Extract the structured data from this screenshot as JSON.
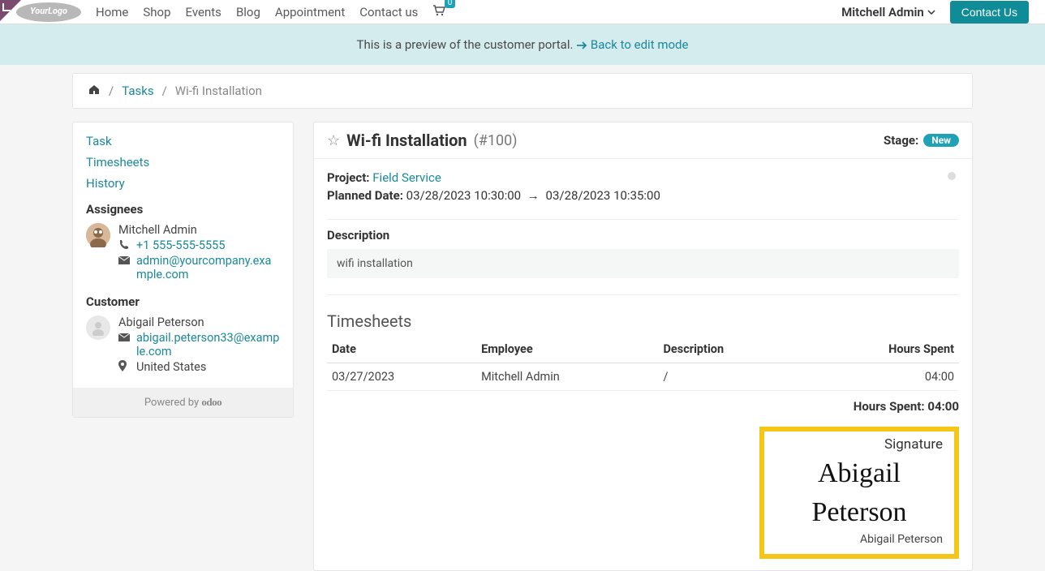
{
  "nav": {
    "logo_text": "YourLogo",
    "links": [
      "Home",
      "Shop",
      "Events",
      "Blog",
      "Appointment",
      "Contact us"
    ],
    "cart_count": "0",
    "user": "Mitchell Admin",
    "contact_btn": "Contact Us"
  },
  "banner": {
    "text": "This is a preview of the customer portal.",
    "link": "Back to edit mode"
  },
  "breadcrumbs": {
    "tasks": "Tasks",
    "current": "Wi-fi Installation"
  },
  "sidebar": {
    "links": {
      "task": "Task",
      "timesheets": "Timesheets",
      "history": "History"
    },
    "assignees_h": "Assignees",
    "assignee": {
      "name": "Mitchell Admin",
      "phone": "+1 555-555-5555",
      "email": "admin@yourcompany.example.com"
    },
    "customer_h": "Customer",
    "customer": {
      "name": "Abigail Peterson",
      "email": "abigail.peterson33@example.com",
      "country": "United States"
    },
    "powered": "Powered by",
    "powered_brand": "odoo"
  },
  "task": {
    "title": "Wi-fi Installation",
    "id": "(#100)",
    "stage_label": "Stage:",
    "stage": "New",
    "project_label": "Project:",
    "project": "Field Service",
    "planned_label": "Planned Date:",
    "planned_start": "03/28/2023 10:30:00",
    "planned_end": "03/28/2023 10:35:00",
    "desc_label": "Description",
    "desc": "wifi installation"
  },
  "timesheets": {
    "title": "Timesheets",
    "cols": {
      "date": "Date",
      "employee": "Employee",
      "desc": "Description",
      "hours": "Hours Spent"
    },
    "rows": [
      {
        "date": "03/27/2023",
        "employee": "Mitchell Admin",
        "desc": "/",
        "hours": "04:00"
      }
    ],
    "total_label": "Hours Spent:",
    "total": "04:00"
  },
  "signature": {
    "title": "Signature",
    "script": "Abigail Peterson",
    "name": "Abigail Peterson"
  }
}
